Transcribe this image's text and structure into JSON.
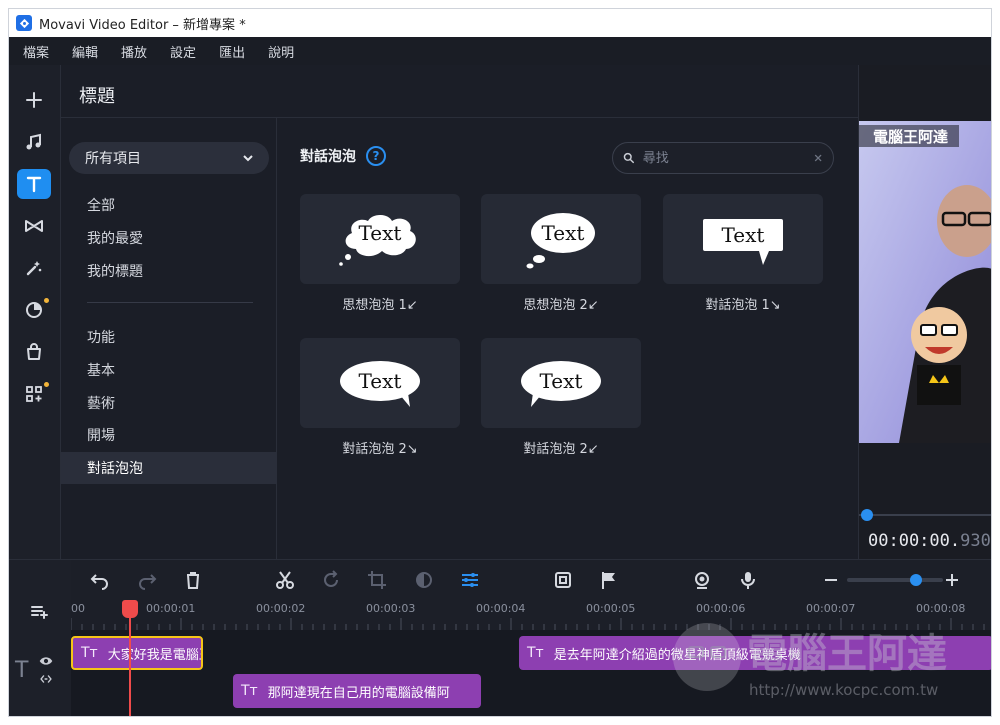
{
  "window": {
    "title": "Movavi Video Editor – 新增專案 *"
  },
  "menu": [
    "檔案",
    "編輯",
    "播放",
    "設定",
    "匯出",
    "說明"
  ],
  "panel": {
    "title": "標題",
    "dropdown": "所有項目",
    "categories_top": [
      "全部",
      "我的最愛",
      "我的標題"
    ],
    "categories_bottom": [
      "功能",
      "基本",
      "藝術",
      "開場",
      "對話泡泡"
    ],
    "selected_category": "對話泡泡"
  },
  "content": {
    "section_title": "對話泡泡",
    "help_glyph": "?",
    "search_placeholder": "尋找",
    "tile_text": "Text",
    "tiles": [
      {
        "label": "思想泡泡 1↙",
        "style": "thought-cloud"
      },
      {
        "label": "思想泡泡 2↙",
        "style": "thought-oval"
      },
      {
        "label": "對話泡泡 1↘",
        "style": "speech-rect"
      },
      {
        "label": "對話泡泡 2↘",
        "style": "speech-oval-right"
      },
      {
        "label": "對話泡泡 2↙",
        "style": "speech-oval-left"
      }
    ]
  },
  "preview": {
    "overlay_text": "電腦王阿達",
    "timecode_main": "00:00:00.",
    "timecode_ms": "930",
    "scrub_position": 0.0
  },
  "timeline": {
    "ruler": [
      "00",
      "00:00:01",
      "00:00:02",
      "00:00:03",
      "00:00:04",
      "00:00:05",
      "00:00:06",
      "00:00:07",
      "00:00:08"
    ],
    "zoom_level": 0.7,
    "clips": [
      {
        "text": "大家好我是電腦王",
        "track": 1,
        "selected": true
      },
      {
        "text": "那阿達現在自己用的電腦設備阿",
        "track": 2,
        "selected": false
      },
      {
        "text": "是去年阿達介紹過的微星神盾頂級電競桌機",
        "track": 1,
        "selected": false
      }
    ],
    "title_track_icon": "T"
  },
  "watermark": {
    "text": "電腦王阿達",
    "url": "http://www.kocpc.com.tw"
  },
  "colors": {
    "accent": "#1f8ef1",
    "clip": "#8d3fb1",
    "playhead": "#ef4b4b",
    "selected_border": "#f5c518"
  }
}
